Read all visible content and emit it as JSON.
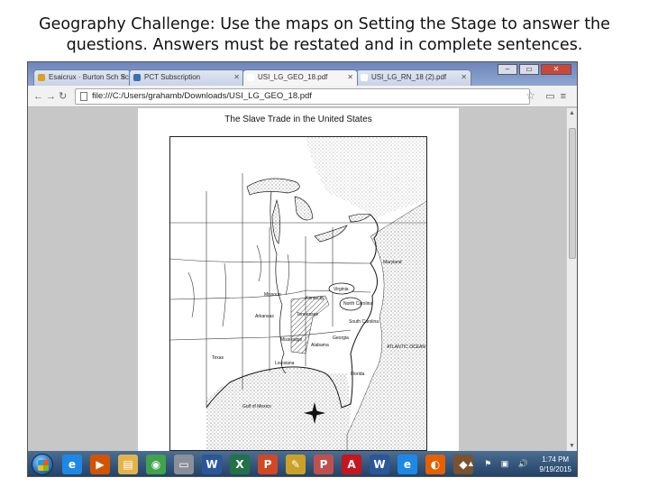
{
  "slide": {
    "title_line1": "Geography Challenge:  Use the maps on Setting the Stage to answer the",
    "title_line2": "questions.  Answers must be restated and in complete sentences."
  },
  "browser": {
    "tabs": [
      {
        "label": "Esaicrux · Burton Sch Scr",
        "favicon_color": "#d9a21f"
      },
      {
        "label": "PCT Subscription",
        "favicon_color": "#3b6fb6"
      },
      {
        "label": "USI_LG_GEO_18.pdf",
        "favicon_color": "#ffffff"
      },
      {
        "label": "USI_LG_RN_18 (2).pdf",
        "favicon_color": "#ffffff"
      }
    ],
    "active_tab": 2,
    "window_controls": {
      "minimize": "–",
      "maximize": "▭",
      "close": "✕"
    },
    "address": "file:///C:/Users/grahamb/Downloads/USI_LG_GEO_18.pdf"
  },
  "pdf": {
    "map_title": "The Slave Trade in the United States",
    "map_labels": {
      "missouri": "Missouri",
      "kentucky": "Kentucky",
      "virginia": "Virginia",
      "maryland": "Maryland",
      "north_carolina": "North Carolina",
      "arkansas": "Arkansas",
      "tennessee": "Tennessee",
      "south_carolina": "South Carolina",
      "georgia": "Georgia",
      "alabama": "Alabama",
      "mississippi": "Mississippi",
      "texas": "Texas",
      "louisiana": "Louisiana",
      "florida": "Florida",
      "atlantic_ocean": "ATLANTIC OCEAN",
      "gulf_of_mexico": "Gulf of Mexico"
    }
  },
  "taskbar": {
    "icons": [
      {
        "name": "ie-icon",
        "glyph": "e",
        "color": "#1e88e5"
      },
      {
        "name": "media-player-icon",
        "glyph": "▶",
        "color": "#d35400"
      },
      {
        "name": "explorer-folder-icon",
        "glyph": "▤",
        "color": "#e3b34b"
      },
      {
        "name": "chrome-icon",
        "glyph": "◉",
        "color": "#3fa34d"
      },
      {
        "name": "drive-icon",
        "glyph": "▭",
        "color": "#8a8f99"
      },
      {
        "name": "word-icon",
        "glyph": "W",
        "color": "#2b579a"
      },
      {
        "name": "excel-icon",
        "glyph": "X",
        "color": "#217346"
      },
      {
        "name": "powerpoint-icon",
        "glyph": "P",
        "color": "#d24726"
      },
      {
        "name": "notepad-icon",
        "glyph": "✎",
        "color": "#c9a227"
      },
      {
        "name": "publisher-icon",
        "glyph": "P",
        "color": "#c0504d"
      },
      {
        "name": "acrobat-icon",
        "glyph": "A",
        "color": "#c4161c"
      },
      {
        "name": "word2-icon",
        "glyph": "W",
        "color": "#2b579a"
      },
      {
        "name": "ie2-icon",
        "glyph": "e",
        "color": "#1e88e5"
      },
      {
        "name": "firefox-icon",
        "glyph": "◐",
        "color": "#e66000"
      },
      {
        "name": "app-icon",
        "glyph": "◆",
        "color": "#7a5230"
      }
    ],
    "clock_time": "1:74 PM",
    "clock_date": "9/19/2015"
  }
}
